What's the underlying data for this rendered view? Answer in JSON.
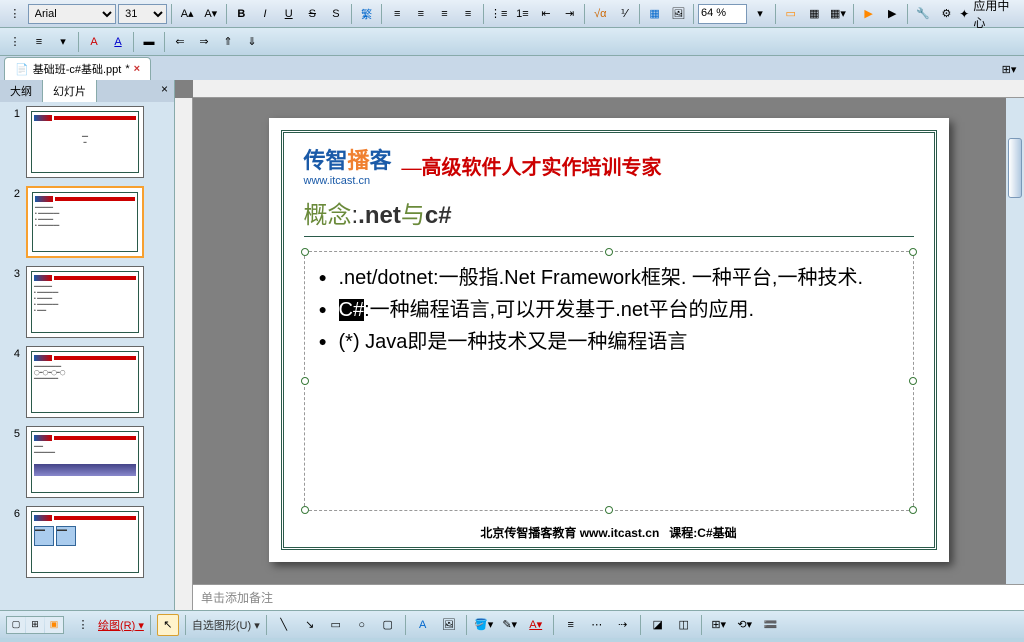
{
  "toolbar": {
    "font_name": "Arial",
    "font_size": "31",
    "zoom": "64 %",
    "app_center": "应用中心",
    "bold": "B",
    "italic": "I",
    "underline": "U",
    "strike": "S"
  },
  "file_tab": {
    "icon": "📄",
    "name": "基础班-c#基础.ppt",
    "modified": "*"
  },
  "sidebar": {
    "tab_outline": "大纲",
    "tab_slides": "幻灯片",
    "close": "×",
    "thumbs": [
      {
        "n": "1"
      },
      {
        "n": "2"
      },
      {
        "n": "3"
      },
      {
        "n": "4"
      },
      {
        "n": "5"
      },
      {
        "n": "6"
      }
    ]
  },
  "slide": {
    "logo_cn": "传智",
    "logo_or": "播",
    "logo_cn2": "客",
    "logo_url": "www.itcast.cn",
    "slogan": "—高级软件人才实作培训专家",
    "title_prefix": "概念",
    "title_colon": ":",
    "title_kw1": ".net",
    "title_mid": "与",
    "title_kw2": "c#",
    "bullets": [
      ".net/dotnet:一般指.Net Framework框架. 一种平台,一种技术.",
      "",
      "(*) Java即是一种技术又是一种编程语言"
    ],
    "b2_sel": "C#",
    "b2_rest": ":一种编程语言,可以开发基于.net平台的应用.",
    "footer_org": "北京传智播客教育 www.itcast.cn",
    "footer_course": "课程:C#基础"
  },
  "notes": {
    "placeholder": "单击添加备注"
  },
  "status": {
    "draw": "绘图(R)",
    "autoshape": "自选图形(U)"
  }
}
